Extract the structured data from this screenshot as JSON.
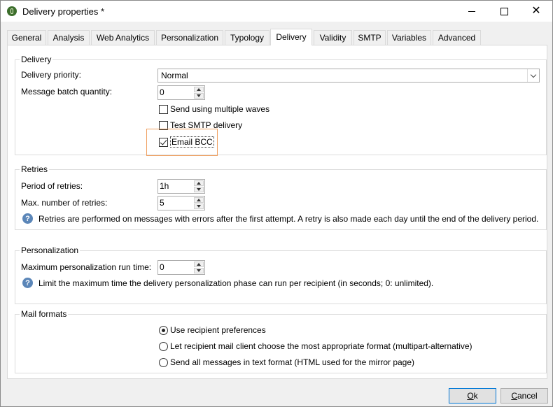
{
  "window": {
    "title": "Delivery properties *"
  },
  "tabs": [
    "General",
    "Analysis",
    "Web Analytics",
    "Personalization",
    "Typology",
    "Delivery",
    "Validity",
    "SMTP",
    "Variables",
    "Advanced"
  ],
  "active_tab": "Delivery",
  "delivery": {
    "title": "Delivery",
    "priority_label": "Delivery priority:",
    "priority_value": "Normal",
    "batch_label": "Message batch quantity:",
    "batch_value": "0",
    "multiple_waves_label": "Send using multiple waves",
    "multiple_waves_checked": false,
    "test_smtp_label": "Test SMTP delivery",
    "test_smtp_checked": false,
    "email_bcc_label": "Email BCC",
    "email_bcc_checked": true
  },
  "retries": {
    "title": "Retries",
    "period_label": "Period of retries:",
    "period_value": "1h",
    "max_label": "Max. number of retries:",
    "max_value": "5",
    "info": "Retries are performed on messages with errors after the first attempt. A retry is also made each day until the end of the delivery period."
  },
  "personalization": {
    "title": "Personalization",
    "runtime_label": "Maximum personalization run time:",
    "runtime_value": "0",
    "info": "Limit the maximum time the delivery personalization phase can run per recipient (in seconds; 0: unlimited)."
  },
  "mail_formats": {
    "title": "Mail formats",
    "options": [
      {
        "label": "Use recipient preferences",
        "selected": true
      },
      {
        "label": "Let recipient mail client choose the most appropriate format (multipart-alternative)",
        "selected": false
      },
      {
        "label": "Send all messages in text format (HTML used for the mirror page)",
        "selected": false
      }
    ]
  },
  "buttons": {
    "ok": "Ok",
    "cancel": "Cancel"
  },
  "colors": {
    "highlight": "#f0a060",
    "default_button_border": "#0078d7",
    "info_icon": "#5b86b8"
  }
}
